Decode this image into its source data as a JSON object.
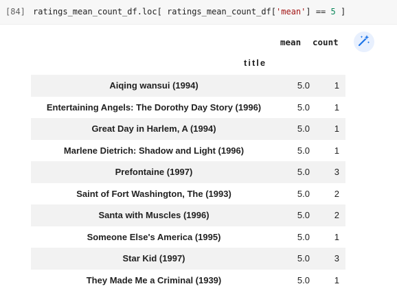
{
  "cell": {
    "exec_count": "[84]",
    "code_prefix": "ratings_mean_count_df.loc[ ratings_mean_count_df[",
    "code_string": "'mean'",
    "code_mid": "] == ",
    "code_number": "5",
    "code_suffix": " ]"
  },
  "table": {
    "columns": {
      "mean": "mean",
      "count": "count"
    },
    "index_name": "title",
    "rows": [
      {
        "title": "Aiqing wansui (1994)",
        "mean": "5.0",
        "count": "1"
      },
      {
        "title": "Entertaining Angels: The Dorothy Day Story (1996)",
        "mean": "5.0",
        "count": "1"
      },
      {
        "title": "Great Day in Harlem, A (1994)",
        "mean": "5.0",
        "count": "1"
      },
      {
        "title": "Marlene Dietrich: Shadow and Light (1996)",
        "mean": "5.0",
        "count": "1"
      },
      {
        "title": "Prefontaine (1997)",
        "mean": "5.0",
        "count": "3"
      },
      {
        "title": "Saint of Fort Washington, The (1993)",
        "mean": "5.0",
        "count": "2"
      },
      {
        "title": "Santa with Muscles (1996)",
        "mean": "5.0",
        "count": "2"
      },
      {
        "title": "Someone Else's America (1995)",
        "mean": "5.0",
        "count": "1"
      },
      {
        "title": "Star Kid (1997)",
        "mean": "5.0",
        "count": "3"
      },
      {
        "title": "They Made Me a Criminal (1939)",
        "mean": "5.0",
        "count": "1"
      }
    ]
  },
  "icons": {
    "magic_button": "magic-wand-sparkle-icon"
  },
  "colors": {
    "accent": "#1a73e8",
    "stripe": "#f2f2f2",
    "cell_bg": "#f7f7f7"
  }
}
